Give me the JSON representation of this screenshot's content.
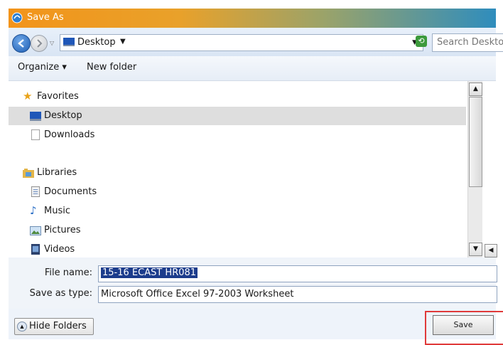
{
  "window": {
    "title": "Save As"
  },
  "navbar": {
    "address": "Desktop",
    "search_placeholder": "Search Desktop"
  },
  "toolbar": {
    "organize": "Organize",
    "new_folder": "New folder"
  },
  "nav_pane": {
    "items": [
      {
        "label": "Favorites",
        "icon": "star-icon",
        "kind": "group"
      },
      {
        "label": "Desktop",
        "icon": "desktop-icon",
        "kind": "item",
        "selected": true
      },
      {
        "label": "Downloads",
        "icon": "document-icon",
        "kind": "item"
      },
      {
        "label": "",
        "icon": "",
        "kind": "spacer"
      },
      {
        "label": "Libraries",
        "icon": "libraries-icon",
        "kind": "group"
      },
      {
        "label": "Documents",
        "icon": "documents-icon",
        "kind": "item"
      },
      {
        "label": "Music",
        "icon": "music-icon",
        "kind": "item"
      },
      {
        "label": "Pictures",
        "icon": "pictures-icon",
        "kind": "item"
      },
      {
        "label": "Videos",
        "icon": "videos-icon",
        "kind": "item"
      }
    ]
  },
  "form": {
    "file_name_label": "File name:",
    "file_name_value": "15-16 ECAST HR081",
    "save_type_label": "Save as type:",
    "save_type_value": "Microsoft Office Excel 97-2003 Worksheet"
  },
  "bottom": {
    "hide_folders": "Hide Folders",
    "save": "Save"
  },
  "colors": {
    "selection": "#1c3c8c",
    "highlight": "#e03a3a"
  }
}
